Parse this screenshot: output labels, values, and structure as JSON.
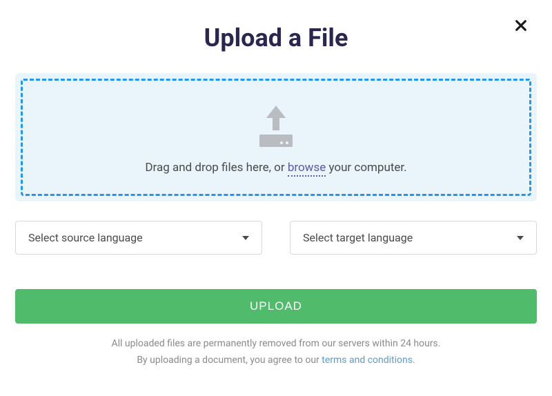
{
  "title": "Upload a File",
  "dropzone": {
    "text_before": "Drag and drop files here, or ",
    "browse_label": "browse",
    "text_after": " your computer."
  },
  "selects": {
    "source_placeholder": "Select source language",
    "target_placeholder": "Select target language"
  },
  "upload_button_label": "UPLOAD",
  "footer": {
    "line1": "All uploaded files are permanently removed from our servers within 24 hours.",
    "line2_before": "By uploading a document, you agree to our ",
    "terms_label": "terms and conditions",
    "line2_after": "."
  },
  "icons": {
    "close": "close-icon",
    "upload": "upload-icon",
    "caret": "chevron-down-icon"
  },
  "colors": {
    "title": "#2a2650",
    "dropzone_bg": "#eaf5fb",
    "dropzone_border": "#2196f3",
    "browse_link": "#5b59b0",
    "upload_btn": "#4fbb6b",
    "terms_link": "#5b9bd5",
    "muted_text": "#8a8a8a",
    "icon_gray": "#b9bcc0"
  }
}
